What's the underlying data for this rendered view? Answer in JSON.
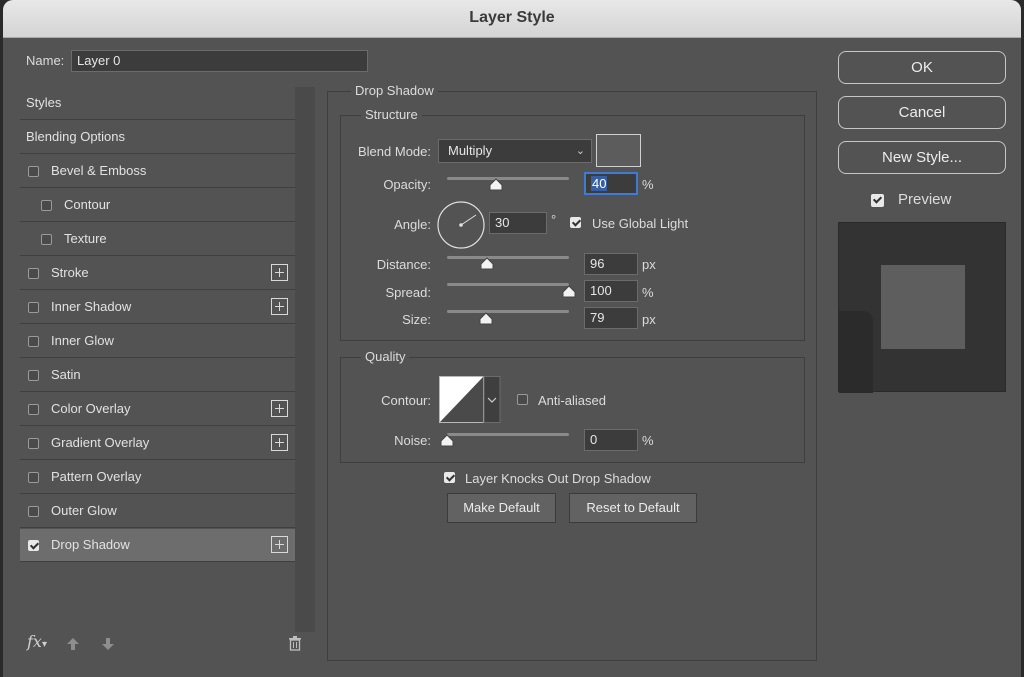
{
  "window": {
    "title": "Layer Style"
  },
  "name_field": {
    "label": "Name:",
    "value": "Layer 0"
  },
  "styles_list": {
    "header": "Styles",
    "blending": "Blending Options",
    "items": [
      {
        "label": "Bevel & Emboss",
        "checked": false,
        "plus": false
      },
      {
        "label": "Contour",
        "checked": false,
        "plus": false
      },
      {
        "label": "Texture",
        "checked": false,
        "plus": false
      },
      {
        "label": "Stroke",
        "checked": false,
        "plus": true
      },
      {
        "label": "Inner Shadow",
        "checked": false,
        "plus": true
      },
      {
        "label": "Inner Glow",
        "checked": false,
        "plus": false
      },
      {
        "label": "Satin",
        "checked": false,
        "plus": false
      },
      {
        "label": "Color Overlay",
        "checked": false,
        "plus": true
      },
      {
        "label": "Gradient Overlay",
        "checked": false,
        "plus": true
      },
      {
        "label": "Pattern Overlay",
        "checked": false,
        "plus": false
      },
      {
        "label": "Outer Glow",
        "checked": false,
        "plus": false
      },
      {
        "label": "Drop Shadow",
        "checked": true,
        "plus": true
      }
    ],
    "footer": {
      "fx": "fx"
    }
  },
  "drop_shadow": {
    "title": "Drop Shadow",
    "structure": {
      "title": "Structure",
      "blend_mode": {
        "label": "Blend Mode:",
        "value": "Multiply",
        "color": "#5c5c5c"
      },
      "opacity": {
        "label": "Opacity:",
        "value": "40",
        "unit": "%",
        "level": 0.4
      },
      "angle": {
        "label": "Angle:",
        "value": "30",
        "unit": "°",
        "global_light_label": "Use Global Light",
        "global_light": true
      },
      "distance": {
        "label": "Distance:",
        "value": "96",
        "unit": "px",
        "level": 0.33
      },
      "spread": {
        "label": "Spread:",
        "value": "100",
        "unit": "%",
        "level": 1.0
      },
      "size": {
        "label": "Size:",
        "value": "79",
        "unit": "px",
        "level": 0.32
      }
    },
    "quality": {
      "title": "Quality",
      "contour": {
        "label": "Contour:",
        "anti_aliased_label": "Anti-aliased",
        "anti_aliased": false
      },
      "noise": {
        "label": "Noise:",
        "value": "0",
        "unit": "%",
        "level": 0
      }
    },
    "knocks_out": {
      "label": "Layer Knocks Out Drop Shadow",
      "checked": true
    },
    "make_default": "Make Default",
    "reset_default": "Reset to Default"
  },
  "buttons": {
    "ok": "OK",
    "cancel": "Cancel",
    "new_style": "New Style..."
  },
  "preview": {
    "label": "Preview",
    "checked": true
  }
}
